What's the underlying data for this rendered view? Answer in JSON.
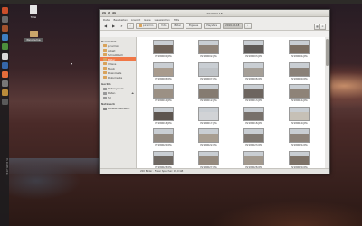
{
  "window": {
    "title": "2019-02-18",
    "menu": [
      "Datei",
      "Bearbeiten",
      "Ansicht",
      "Gehe",
      "Lesezeichen",
      "Hilfe"
    ],
    "breadcrumbs": [
      "picarmin",
      "foto",
      "Bilder",
      "Eigenes",
      "Playstore",
      "2019-02-18"
    ],
    "search_placeholder": "",
    "status": "200 Bilder · Freier Speicher: 45,0 GB"
  },
  "sidebar": {
    "sections": [
      {
        "title": "Persönlich",
        "items": [
          {
            "label": "picarmin",
            "selected": false
          },
          {
            "label": "Arbeit",
            "selected": false
          },
          {
            "label": "Schreibtisch",
            "selected": false
          },
          {
            "label": "Bilder",
            "selected": true
          },
          {
            "label": "Videos",
            "selected": false
          },
          {
            "label": "Musik",
            "selected": false
          },
          {
            "label": "Downloads",
            "selected": false
          },
          {
            "label": "Dokumente",
            "selected": false
          }
        ]
      },
      {
        "title": "Geräte",
        "items": [
          {
            "label": "Dateisystem",
            "selected": false
          },
          {
            "label": "Daten",
            "selected": false
          },
          {
            "label": "SD",
            "selected": false
          }
        ]
      },
      {
        "title": "Netzwerk",
        "items": [
          {
            "label": "Lokales Netzwerk",
            "selected": false
          }
        ]
      }
    ]
  },
  "desktop_icons": [
    {
      "label": "Tulsi"
    },
    {
      "label": "Panorama"
    }
  ],
  "launcher": {
    "clock": "Mi. 11. 05, 23:15"
  },
  "files": [
    {
      "name": "P2180001.JPG",
      "color": "#6e6258"
    },
    {
      "name": "P2180002.JPG",
      "color": "#8f8378"
    },
    {
      "name": "P2180003.JPG",
      "color": "#5f5a57"
    },
    {
      "name": "P2180004.JPG",
      "color": "#7b6e62"
    },
    {
      "name": "P2180005.JPG",
      "color": "#9a8d80"
    },
    {
      "name": "P2180006.JPG",
      "color": "#a89b8d"
    },
    {
      "name": "P2180007.JPG",
      "color": "#bfc3c7"
    },
    {
      "name": "P2180008.JPG",
      "color": "#a59f97"
    },
    {
      "name": "P2180009.JPG",
      "color": "#8a8178"
    },
    {
      "name": "P2180010.JPG",
      "color": "#b3a898"
    },
    {
      "name": "P2180011.JPG",
      "color": "#9b9084"
    },
    {
      "name": "P2180012.JPG",
      "color": "#857b71"
    },
    {
      "name": "P2180013.JPG",
      "color": "#6d655f"
    },
    {
      "name": "P2180014.JPG",
      "color": "#8e8378"
    },
    {
      "name": "P2180015.JPG",
      "color": "#a09484"
    },
    {
      "name": "P2180016.JPG",
      "color": "#5d554f"
    },
    {
      "name": "P2180017.JPG",
      "color": "#d1d3d6"
    },
    {
      "name": "P2180018.JPG",
      "color": "#77706a"
    },
    {
      "name": "P2180019.JPG",
      "color": "#c6c0b6"
    },
    {
      "name": "P2180020.JPG",
      "color": "#80766c"
    },
    {
      "name": "P2180021.JPG",
      "color": "#938a80"
    },
    {
      "name": "P2180022.JPG",
      "color": "#a89e91"
    },
    {
      "name": "P2180023.JPG",
      "color": "#7f7871"
    },
    {
      "name": "P2180024.JPG",
      "color": "#8d837a"
    },
    {
      "name": "P2180025.JPG",
      "color": "#b5a999"
    },
    {
      "name": "P2180026.JPG",
      "color": "#6f6862"
    },
    {
      "name": "P2180027.JPG",
      "color": "#958a7e"
    },
    {
      "name": "P2180028.JPG",
      "color": "#a2998e"
    },
    {
      "name": "P2180029.JPG",
      "color": "#7d7268"
    },
    {
      "name": "P2180030.JPG",
      "color": "#c9c2b7"
    },
    {
      "name": "P2180031.JPG",
      "color": "#5e5650"
    },
    {
      "name": "P2180032.JPG",
      "color": "#8b8175"
    },
    {
      "name": "P2180033.JPG",
      "color": "#9e9386"
    },
    {
      "name": "P2180034.JPG",
      "color": "#6a625b"
    },
    {
      "name": "P2180035.JPG",
      "color": "#b8ad9f"
    }
  ]
}
